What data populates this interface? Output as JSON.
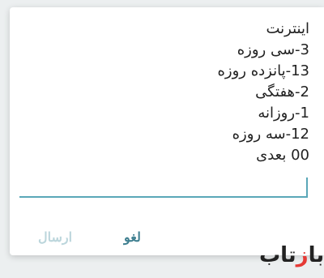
{
  "options": [
    "اینترنت",
    "3-سی روزه",
    "13-پانزده روزه",
    "2-هفتگی",
    "1-روزانه",
    "12-سه روزه",
    "00 بعدی"
  ],
  "actions": {
    "cancel_label": "لغو",
    "send_label": "ارسال"
  },
  "watermark": {
    "text": "بازتاب"
  },
  "colors": {
    "accent": "#5aa7b8",
    "cancel": "#3f7f90",
    "send_disabled": "#bcd6dc"
  }
}
